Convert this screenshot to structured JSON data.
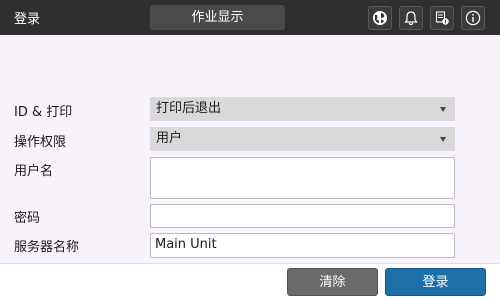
{
  "header": {
    "title": "登录",
    "job_display_label": "作业显示",
    "icons": [
      "globe-icon",
      "bell-icon",
      "device-status-icon",
      "info-icon"
    ]
  },
  "form": {
    "id_print": {
      "label": "ID & 打印",
      "value": "打印后退出"
    },
    "permission": {
      "label": "操作权限",
      "value": "用户"
    },
    "username": {
      "label": "用户名",
      "value": ""
    },
    "password": {
      "label": "密码",
      "value": ""
    },
    "server": {
      "label": "服务器名称",
      "value": "Main Unit"
    }
  },
  "footer": {
    "clear_label": "清除",
    "login_label": "登录"
  },
  "colors": {
    "topbar": "#2f2f2f",
    "background": "#f8f2fb",
    "select_bg": "#d9d9d9",
    "clear_button": "#6b6b6b",
    "login_button": "#1e6fa8"
  }
}
